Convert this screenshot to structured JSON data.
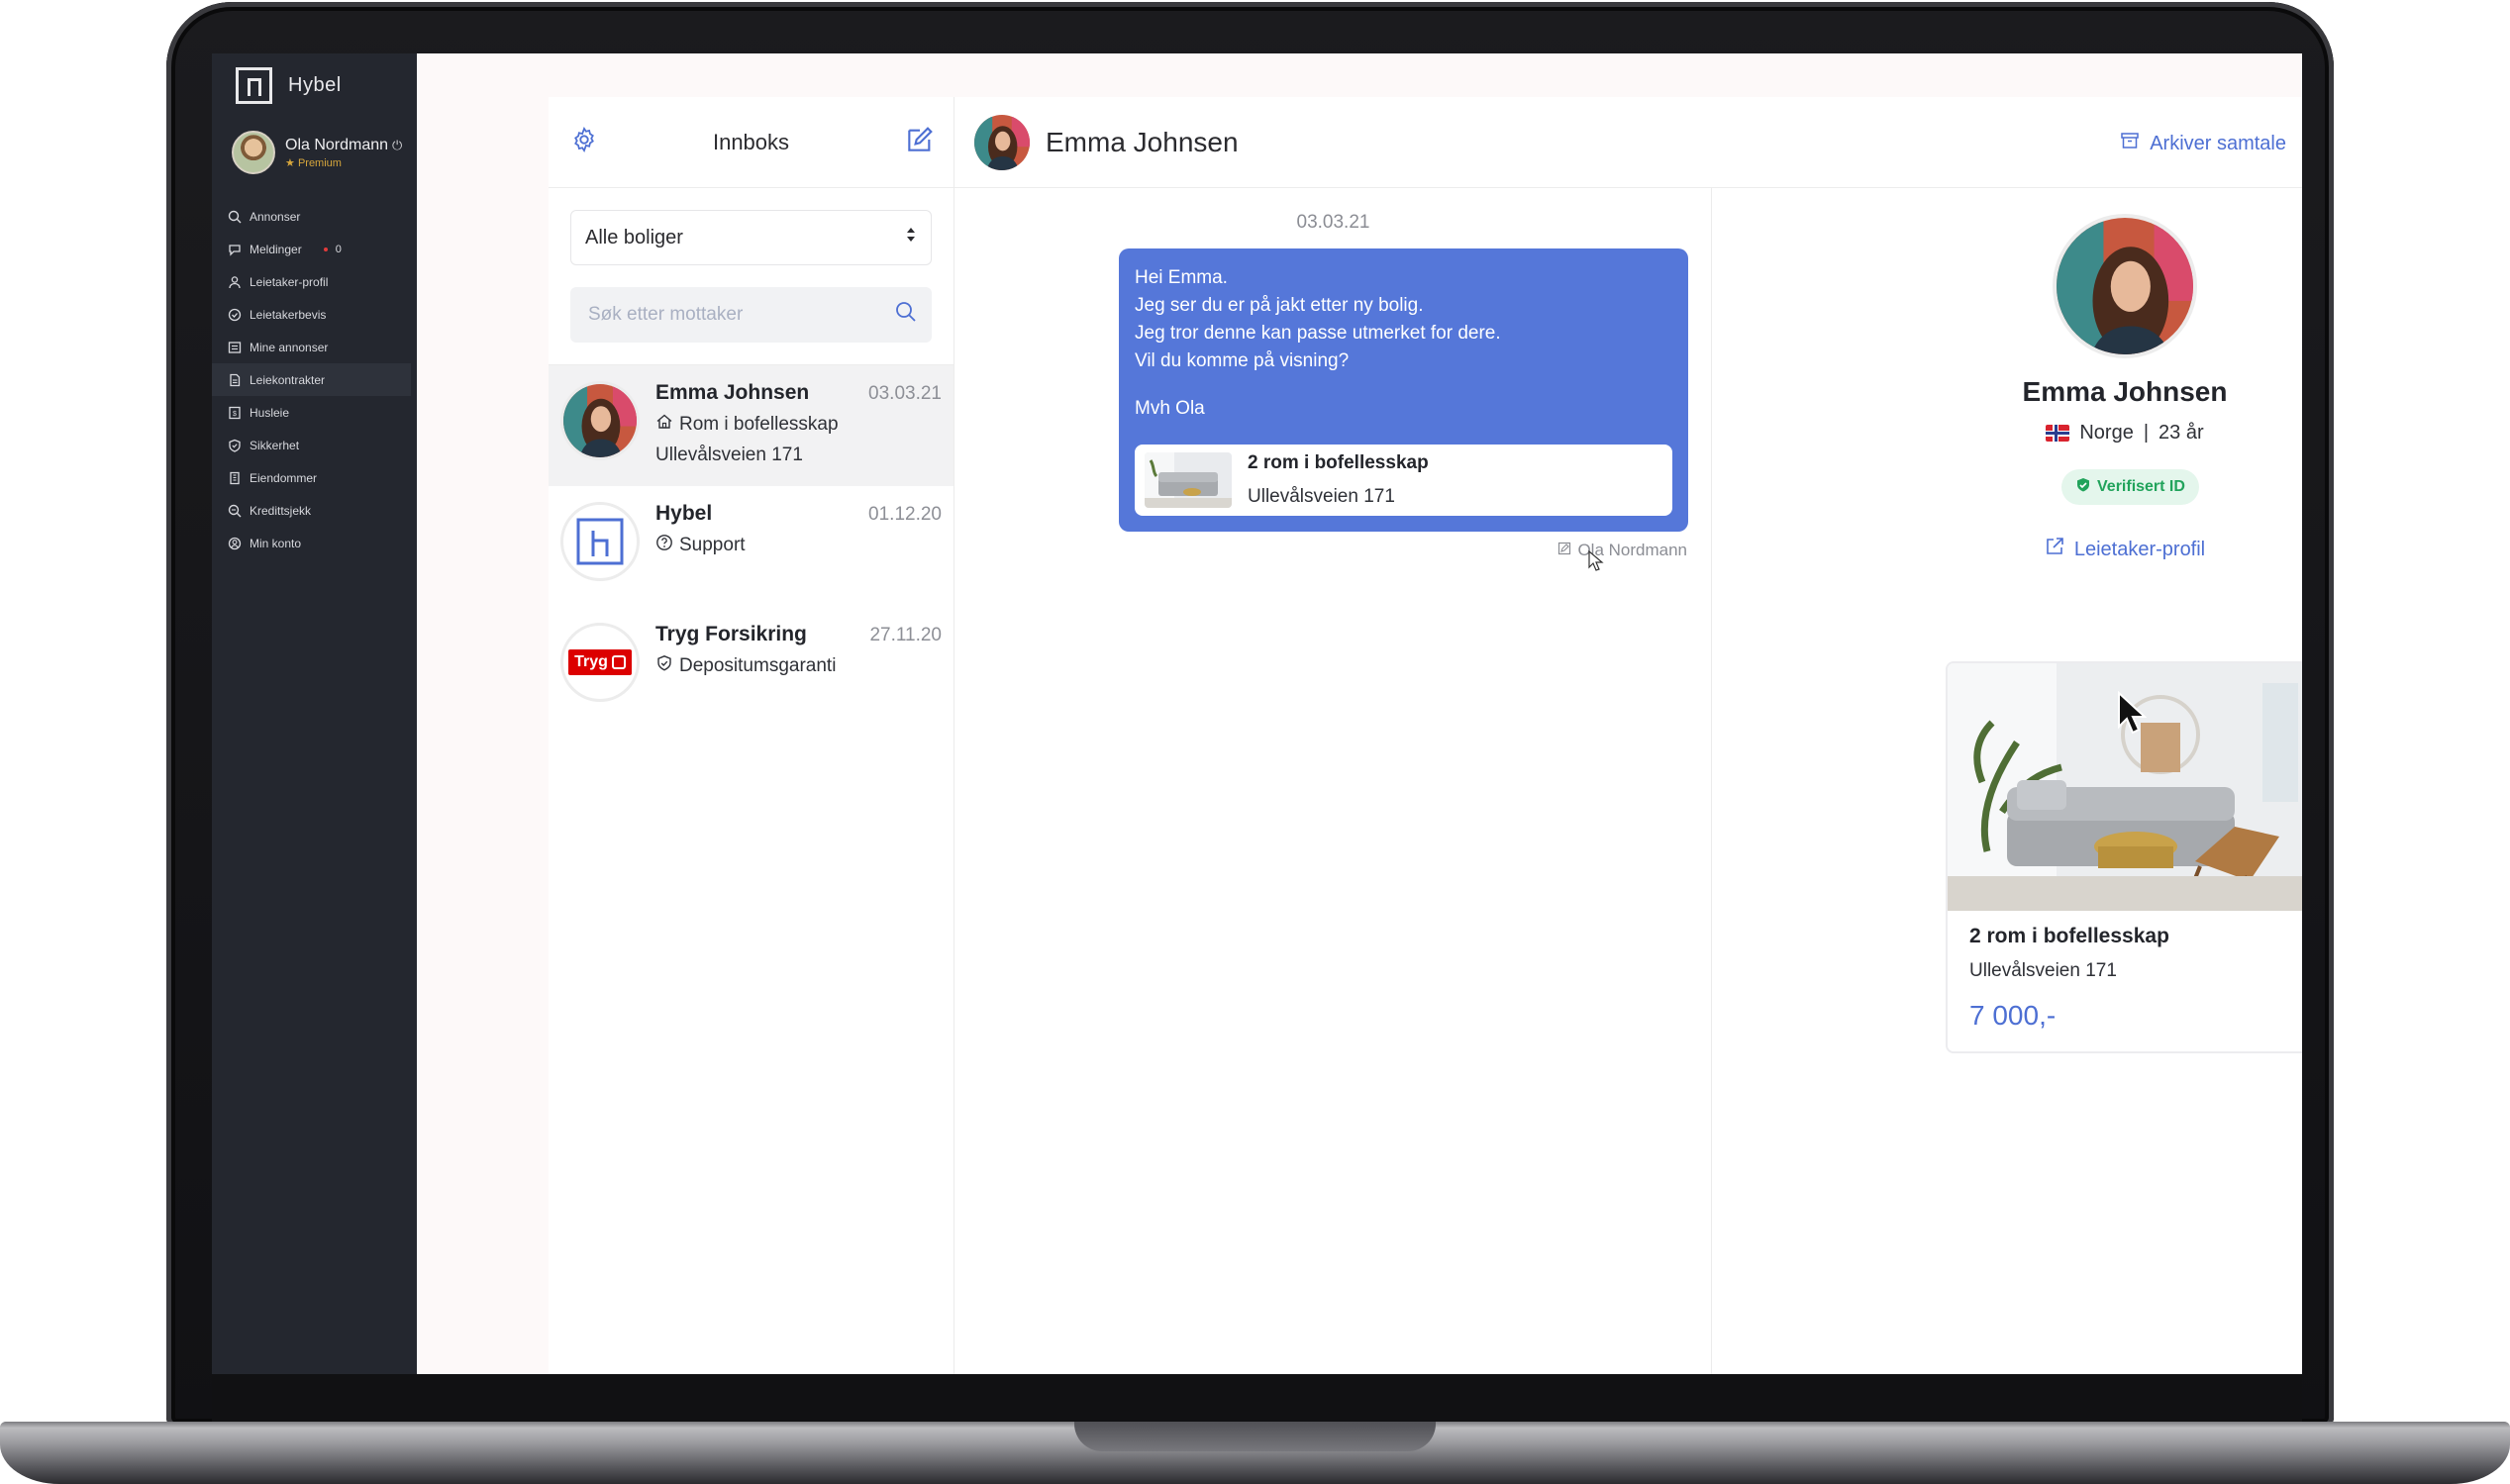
{
  "brand": {
    "name": "Hybel"
  },
  "user": {
    "name": "Ola Nordmann",
    "tier": "Premium"
  },
  "nav": [
    {
      "label": "Annonser",
      "icon": "search-icon"
    },
    {
      "label": "Meldinger",
      "icon": "chat-icon",
      "badge": "0"
    },
    {
      "label": "Leietaker-profil",
      "icon": "user-icon"
    },
    {
      "label": "Leietakerbevis",
      "icon": "check-circle-icon"
    },
    {
      "label": "Mine annonser",
      "icon": "list-icon"
    },
    {
      "label": "Leiekontrakter",
      "icon": "document-icon",
      "active": true
    },
    {
      "label": "Husleie",
      "icon": "rent-icon"
    },
    {
      "label": "Sikkerhet",
      "icon": "shield-icon"
    },
    {
      "label": "Eiendommer",
      "icon": "building-icon"
    },
    {
      "label": "Kredittsjekk",
      "icon": "magnifier-icon"
    },
    {
      "label": "Min konto",
      "icon": "account-icon"
    }
  ],
  "inbox": {
    "title": "Innboks",
    "filter": "Alle boliger",
    "search_placeholder": "Søk etter mottaker",
    "conversations": [
      {
        "name": "Emma Johnsen",
        "date": "03.03.21",
        "line1": "Rom i bofellesskap",
        "line2": "Ullevålsveien 171",
        "icon": "home-icon"
      },
      {
        "name": "Hybel",
        "date": "01.12.20",
        "line1": "Support",
        "icon": "help-icon"
      },
      {
        "name": "Tryg Forsikring",
        "date": "27.11.20",
        "line1": "Depositumsgaranti",
        "icon": "shield-check-icon",
        "logo_text": "Tryg"
      }
    ]
  },
  "chat": {
    "contact": "Emma Johnsen",
    "archive_label": "Arkiver samtale",
    "date": "03.03.21",
    "message_lines": [
      "Hei Emma.",
      "Jeg ser du er på jakt etter ny bolig.",
      "Jeg tror denne kan passe utmerket for dere.",
      "Vil du komme på visning?"
    ],
    "signature": "Mvh Ola",
    "attachment": {
      "title": "2 rom i bofellesskap",
      "address": "Ullevålsveien 171"
    },
    "sender": "Ola Nordmann"
  },
  "profile": {
    "name": "Emma Johnsen",
    "country": "Norge",
    "separator": "|",
    "age": "23 år",
    "verified_label": "Verifisert ID",
    "profile_link": "Leietaker-profil",
    "listing": {
      "title": "2 rom i bofellesskap",
      "address": "Ullevålsveien 171",
      "price": "7 000,-"
    }
  },
  "colors": {
    "accent": "#5577d9",
    "sidebar": "#24272f",
    "verified": "#21a35b",
    "tryg": "#dc0000"
  }
}
